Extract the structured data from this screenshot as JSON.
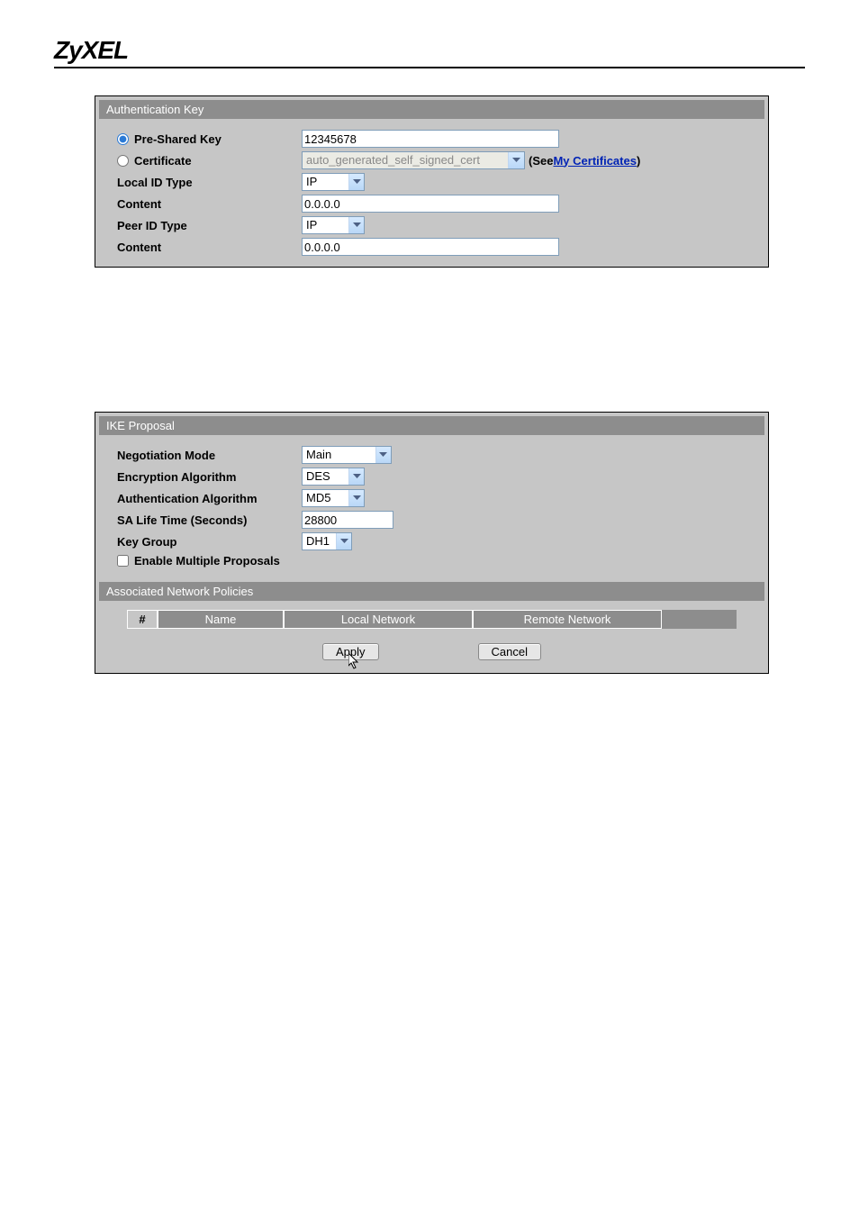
{
  "brand": "ZyXEL",
  "auth": {
    "header": "Authentication Key",
    "psk_label": "Pre-Shared Key",
    "psk_value": "12345678",
    "cert_label": "Certificate",
    "cert_value": "auto_generated_self_signed_cert",
    "cert_see_prefix": "(See ",
    "cert_link": "My Certificates",
    "cert_see_suffix": ")",
    "local_id_type_label": "Local ID Type",
    "local_id_type_value": "IP",
    "local_content_label": "Content",
    "local_content_value": "0.0.0.0",
    "peer_id_type_label": "Peer ID Type",
    "peer_id_type_value": "IP",
    "peer_content_label": "Content",
    "peer_content_value": "0.0.0.0"
  },
  "ike": {
    "header": "IKE Proposal",
    "neg_mode_label": "Negotiation Mode",
    "neg_mode_value": "Main",
    "enc_alg_label": "Encryption Algorithm",
    "enc_alg_value": "DES",
    "auth_alg_label": "Authentication Algorithm",
    "auth_alg_value": "MD5",
    "sa_life_label": "SA Life Time (Seconds)",
    "sa_life_value": "28800",
    "key_group_label": "Key Group",
    "key_group_value": "DH1",
    "multi_prop_label": "Enable Multiple Proposals"
  },
  "assoc": {
    "header": "Associated Network Policies",
    "col_num": "#",
    "col_name": "Name",
    "col_local": "Local Network",
    "col_remote": "Remote Network"
  },
  "buttons": {
    "apply": "Apply",
    "cancel": "Cancel"
  }
}
